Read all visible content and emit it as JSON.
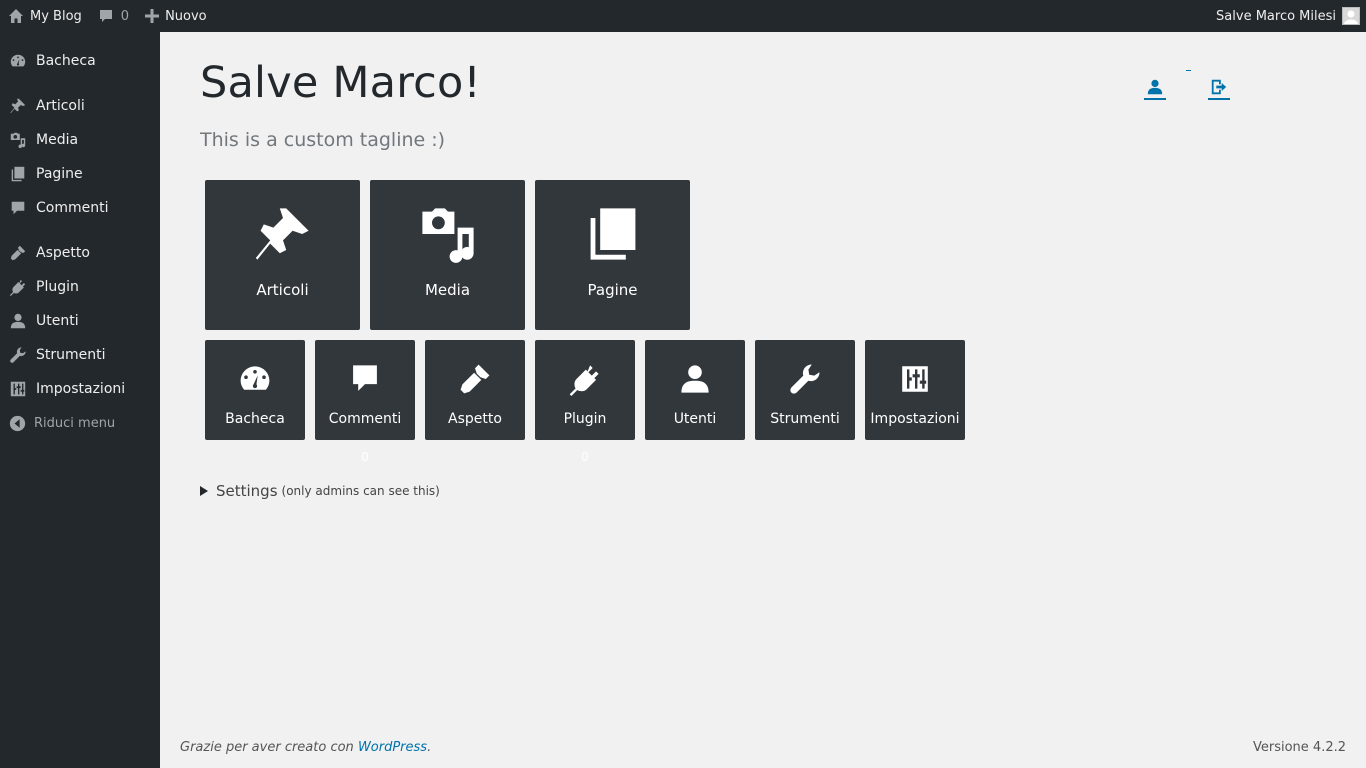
{
  "adminbar": {
    "site_name": "My Blog",
    "comments_count": "0",
    "new_label": "Nuovo",
    "greeting": "Salve Marco Milesi"
  },
  "sidebar": {
    "items": [
      {
        "label": "Bacheca",
        "icon": "dashboard-icon"
      },
      {
        "label": "Articoli",
        "icon": "pushpin-icon"
      },
      {
        "label": "Media",
        "icon": "media-icon"
      },
      {
        "label": "Pagine",
        "icon": "pages-icon"
      },
      {
        "label": "Commenti",
        "icon": "comment-icon"
      },
      {
        "label": "Aspetto",
        "icon": "brush-icon"
      },
      {
        "label": "Plugin",
        "icon": "plug-icon"
      },
      {
        "label": "Utenti",
        "icon": "user-icon"
      },
      {
        "label": "Strumenti",
        "icon": "wrench-icon"
      },
      {
        "label": "Impostazioni",
        "icon": "settings-icon"
      }
    ],
    "collapse_label": "Riduci menu"
  },
  "main": {
    "title": "Salve Marco!",
    "tagline": "This is a custom tagline :)",
    "big_tiles": [
      {
        "label": "Articoli",
        "icon": "pushpin-icon"
      },
      {
        "label": "Media",
        "icon": "media-icon"
      },
      {
        "label": "Pagine",
        "icon": "pages-icon"
      }
    ],
    "small_tiles": [
      {
        "label": "Bacheca",
        "icon": "dashboard-icon"
      },
      {
        "label": "Commenti",
        "icon": "comment-icon",
        "count": "0"
      },
      {
        "label": "Aspetto",
        "icon": "brush-icon"
      },
      {
        "label": "Plugin",
        "icon": "plug-icon",
        "count": "0"
      },
      {
        "label": "Utenti",
        "icon": "user-icon"
      },
      {
        "label": "Strumenti",
        "icon": "wrench-icon"
      },
      {
        "label": "Impostazioni",
        "icon": "settings-icon"
      }
    ],
    "settings_label": "Settings",
    "settings_note": "(only admins can see this)"
  },
  "footer": {
    "thanks_prefix": "Grazie per aver creato con ",
    "thanks_link": "WordPress",
    "thanks_suffix": ".",
    "version": "Versione 4.2.2"
  },
  "colors": {
    "sidebar_bg": "#23282d",
    "tile_bg": "#32373c",
    "content_bg": "#f1f1f1",
    "link": "#0073aa"
  }
}
